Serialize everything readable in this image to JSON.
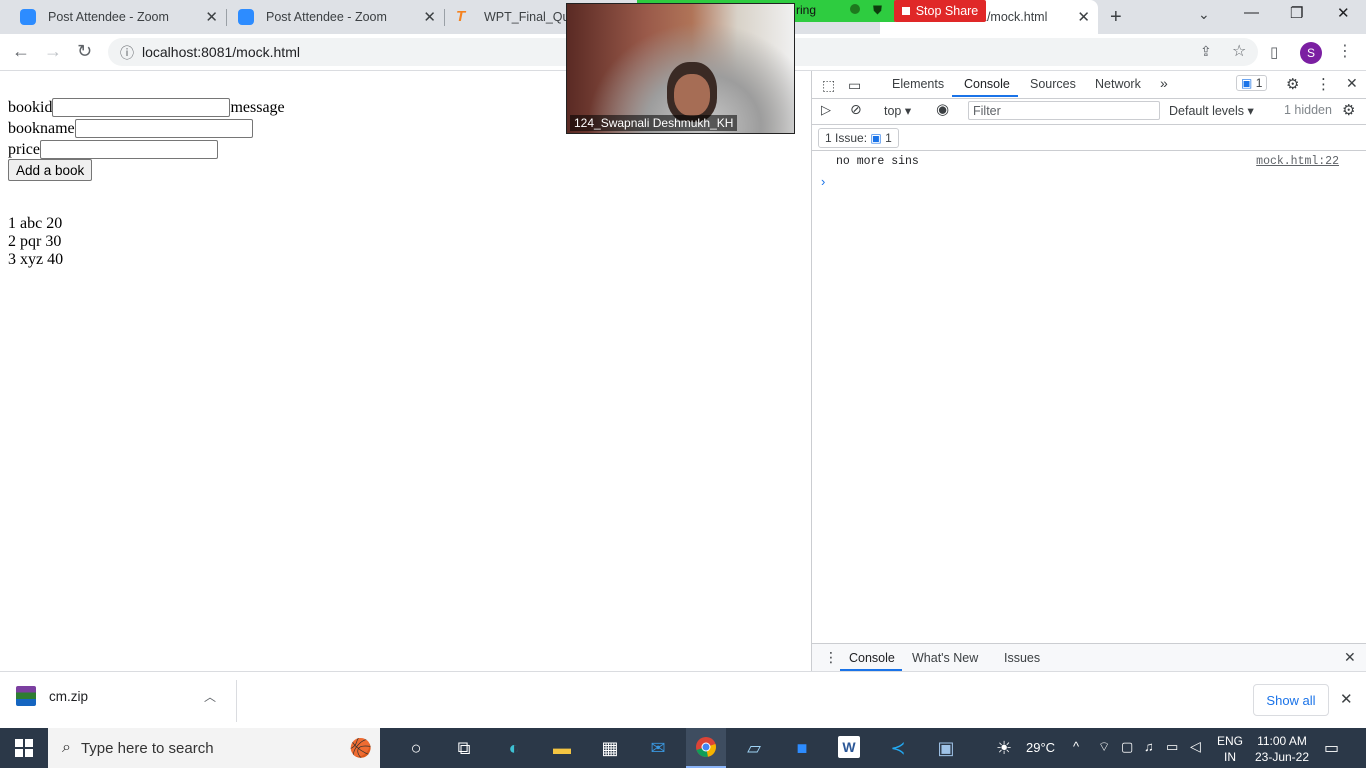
{
  "tabs": [
    {
      "title": "Post Attendee - Zoom",
      "icon": "zoom-icon"
    },
    {
      "title": "Post Attendee - Zoom",
      "icon": "zoom-icon"
    },
    {
      "title": "WPT_Final_Quiz-",
      "icon": "testbook-icon"
    },
    {
      "title": "1/mock.html",
      "icon": "page-icon"
    }
  ],
  "url": "localhost:8081/mock.html",
  "profile_initial": "S",
  "page": {
    "bookid_label": "bookid",
    "message_label": "message",
    "bookname_label": "bookname",
    "price_label": "price",
    "add_button": "Add a book",
    "books": [
      "1 abc 20",
      "2 pqr 30",
      "3 xyz 40"
    ]
  },
  "zoom": {
    "sharing_text": "ring",
    "stop_share": "Stop Share",
    "participant": "124_Swapnali Deshmukh_KH"
  },
  "devtools": {
    "tabs": [
      "Elements",
      "Console",
      "Sources",
      "Network"
    ],
    "active_tab": "Console",
    "issue_badge": "1",
    "context": "top",
    "filter_placeholder": "Filter",
    "levels": "Default levels",
    "hidden": "1 hidden",
    "issues_label": "1 Issue:",
    "issues_count": "1",
    "log_message": "no more sins",
    "log_source": "mock.html:22",
    "drawer_tabs": [
      "Console",
      "What's New",
      "Issues"
    ]
  },
  "download": {
    "file": "cm.zip",
    "show_all": "Show all"
  },
  "taskbar": {
    "search_placeholder": "Type here to search",
    "temperature": "29°C",
    "lang1": "ENG",
    "lang2": "IN",
    "time": "11:00 AM",
    "date": "23-Jun-22"
  },
  "colors": {
    "zoom_blue": "#2d8cff",
    "share_green": "#2ecc40",
    "stop_red": "#e02828",
    "devtools_blue": "#1a73e8",
    "taskbar": "#2b3848"
  }
}
